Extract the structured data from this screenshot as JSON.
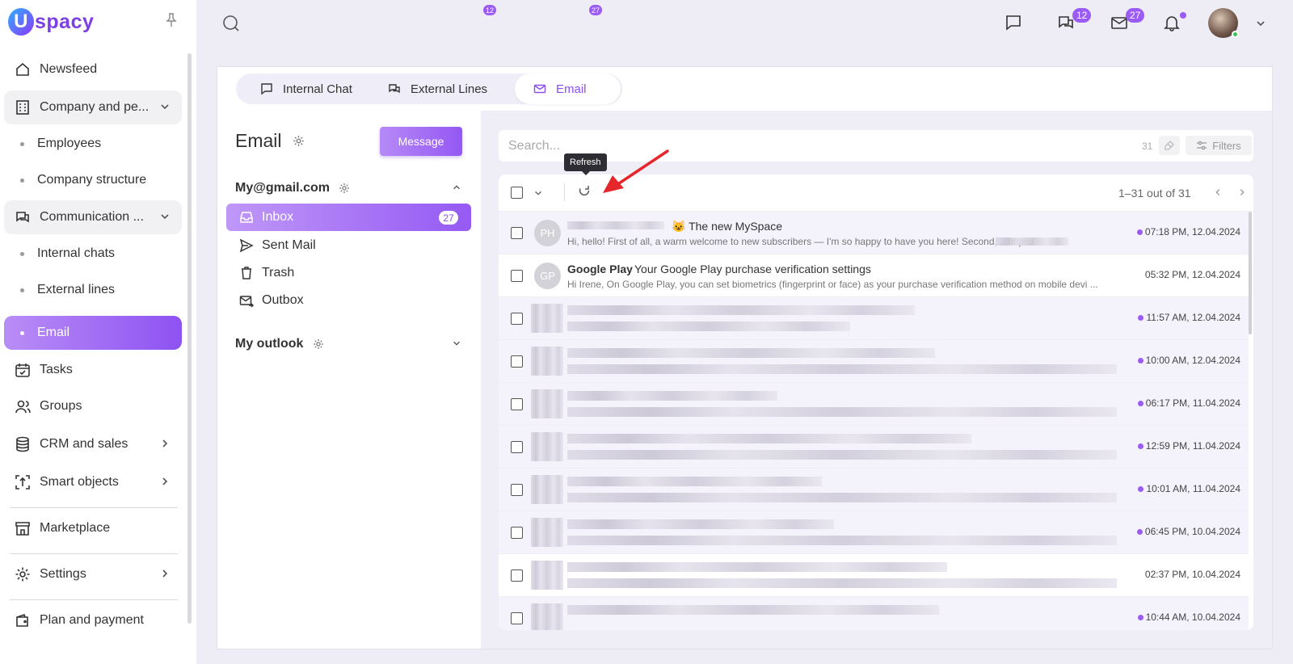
{
  "logo": {
    "letter": "U",
    "text": "spacy"
  },
  "sidebar": {
    "items": [
      {
        "label": "Newsfeed"
      },
      {
        "label": "Company and pe..."
      },
      {
        "label": "Employees"
      },
      {
        "label": "Company structure"
      },
      {
        "label": "Communication ..."
      },
      {
        "label": "Internal chats"
      },
      {
        "label": "External lines"
      },
      {
        "label": "Email"
      },
      {
        "label": "Tasks"
      },
      {
        "label": "Groups"
      },
      {
        "label": "CRM and sales"
      },
      {
        "label": "Smart objects"
      },
      {
        "label": "Marketplace"
      },
      {
        "label": "Settings"
      },
      {
        "label": "Plan and payment"
      }
    ]
  },
  "header": {
    "chats_badge": "12",
    "mail_badge": "27"
  },
  "tabs": [
    {
      "label": "Internal Chat"
    },
    {
      "label": "External Lines",
      "badge": "12"
    },
    {
      "label": "Email",
      "badge": "27"
    }
  ],
  "mail": {
    "title": "Email",
    "message_button": "Message",
    "accounts": [
      {
        "name": "My@gmail.com"
      },
      {
        "name": "My outlook"
      }
    ],
    "folders": [
      {
        "label": "Inbox",
        "badge": "27"
      },
      {
        "label": "Sent Mail"
      },
      {
        "label": "Trash"
      },
      {
        "label": "Outbox"
      }
    ],
    "search": {
      "placeholder": "Search...",
      "count": "31",
      "filters_label": "Filters"
    },
    "tooltip": "Refresh",
    "pager": "1–31 out of 31",
    "emails": [
      {
        "initials": "PH",
        "sender": "",
        "subject": "😺 The new MySpace",
        "preview": "Hi, hello! First of all, a warm welcome to new subscribers — I'm so happy to have you here! Second,...                              https:/",
        "time": "07:18 PM, 12.04.2024",
        "unread": true
      },
      {
        "initials": "GP",
        "sender": "Google Play",
        "subject": "Your Google Play purchase verification settings",
        "preview": "Hi Irene,    On Google Play, you can set biometrics (fingerprint or face) as your  purchase verification method on mobile devi ...",
        "time": "05:32 PM, 12.04.2024",
        "unread": false
      },
      {
        "initials": "",
        "sender": "",
        "subject": "",
        "preview": "",
        "time": "11:57 AM, 12.04.2024",
        "unread": true
      },
      {
        "initials": "",
        "sender": "",
        "subject": "",
        "preview": "",
        "time": "10:00 AM, 12.04.2024",
        "unread": true
      },
      {
        "initials": "",
        "sender": "",
        "subject": "",
        "preview": "",
        "time": "06:17 PM, 11.04.2024",
        "unread": true
      },
      {
        "initials": "",
        "sender": "",
        "subject": "",
        "preview": "",
        "time": "12:59 PM, 11.04.2024",
        "unread": true
      },
      {
        "initials": "",
        "sender": "",
        "subject": "",
        "preview": "",
        "time": "10:01 AM, 11.04.2024",
        "unread": true
      },
      {
        "initials": "",
        "sender": "",
        "subject": "",
        "preview": "",
        "time": "06:45 PM, 10.04.2024",
        "unread": true
      },
      {
        "initials": "",
        "sender": "",
        "subject": "",
        "preview": "",
        "time": "02:37 PM, 10.04.2024",
        "unread": false
      },
      {
        "initials": "",
        "sender": "",
        "subject": "",
        "preview": "",
        "time": "10:44 AM, 10.04.2024",
        "unread": true
      }
    ]
  },
  "colors": {
    "accent": "#9b5cf6",
    "accent_light": "#b98df7",
    "panel_bg": "#efeef6"
  }
}
